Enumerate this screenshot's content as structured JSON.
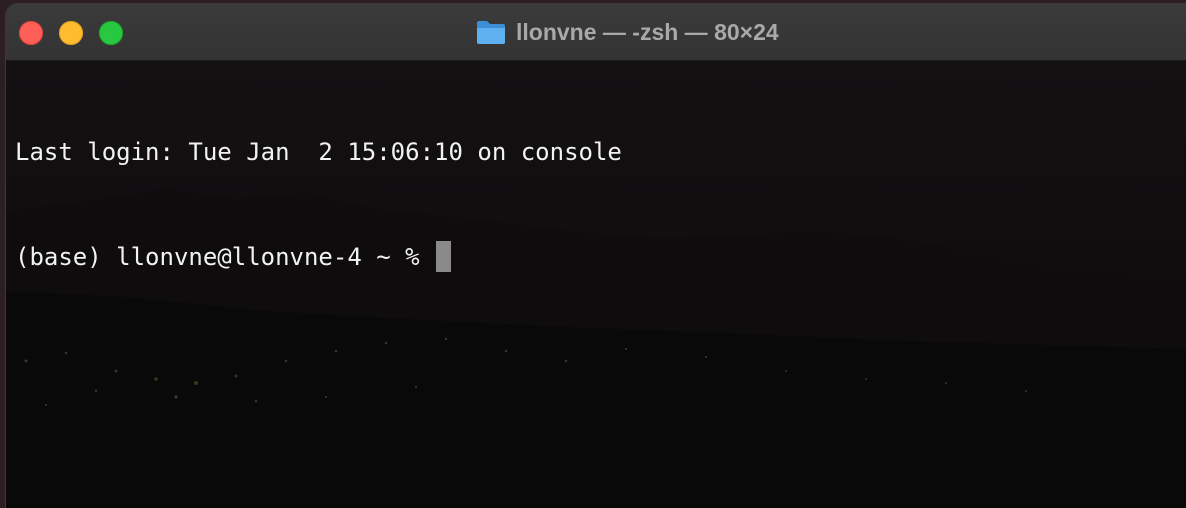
{
  "window": {
    "title": "llonvne — -zsh — 80×24",
    "title_icon": "folder-icon",
    "controls": {
      "close_color": "#ff5f57",
      "minimize_color": "#febc2e",
      "zoom_color": "#28c840"
    }
  },
  "terminal": {
    "lines": [
      "Last login: Tue Jan  2 15:06:10 on console",
      "(base) llonvne@llonvne-4 ~ % "
    ],
    "text_color": "#f2f2f2",
    "cursor_color": "#8a8a8a"
  }
}
